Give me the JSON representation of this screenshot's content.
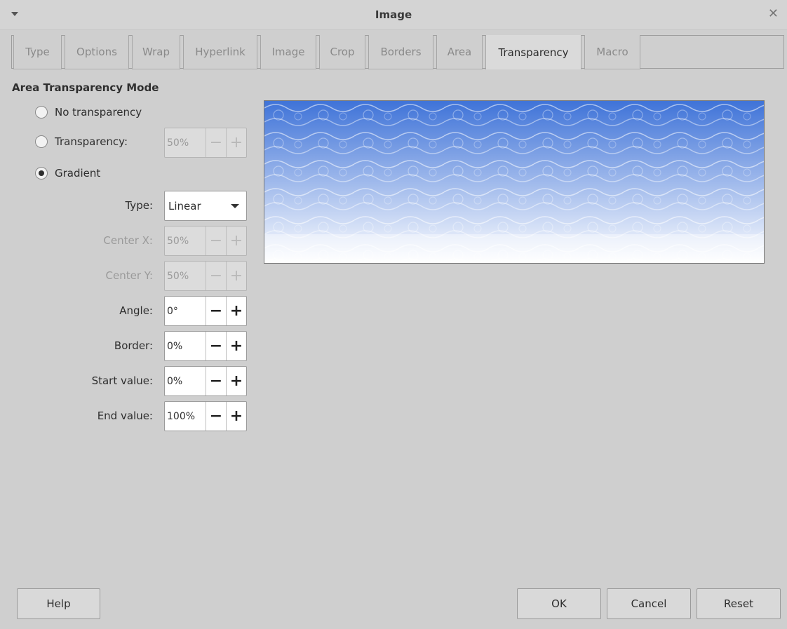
{
  "window": {
    "title": "Image"
  },
  "tabs": [
    {
      "label": "Type"
    },
    {
      "label": "Options"
    },
    {
      "label": "Wrap"
    },
    {
      "label": "Hyperlink"
    },
    {
      "label": "Image"
    },
    {
      "label": "Crop"
    },
    {
      "label": "Borders"
    },
    {
      "label": "Area"
    },
    {
      "label": "Transparency",
      "active": true
    },
    {
      "label": "Macro"
    }
  ],
  "section": {
    "title": "Area Transparency Mode"
  },
  "mode": {
    "no_transparency": "No transparency",
    "transparency": "Transparency:",
    "transparency_value": "50%",
    "gradient": "Gradient",
    "selected": "gradient"
  },
  "fields": {
    "type_label": "Type:",
    "type_value": "Linear",
    "center_x_label": "Center X:",
    "center_x_value": "50%",
    "center_y_label": "Center Y:",
    "center_y_value": "50%",
    "angle_label": "Angle:",
    "angle_value": "0°",
    "border_label": "Border:",
    "border_value": "0%",
    "start_label": "Start value:",
    "start_value": "0%",
    "end_label": "End value:",
    "end_value": "100%",
    "minus": "−",
    "plus": "+"
  },
  "buttons": {
    "help": "Help",
    "ok": "OK",
    "cancel": "Cancel",
    "reset": "Reset"
  },
  "icons": {
    "menu": "window-menu-icon",
    "close": "close-icon",
    "dropdown": "chevron-down-icon"
  },
  "colors": {
    "preview_top": "#3f73d8",
    "preview_bottom": "#ffffff"
  }
}
